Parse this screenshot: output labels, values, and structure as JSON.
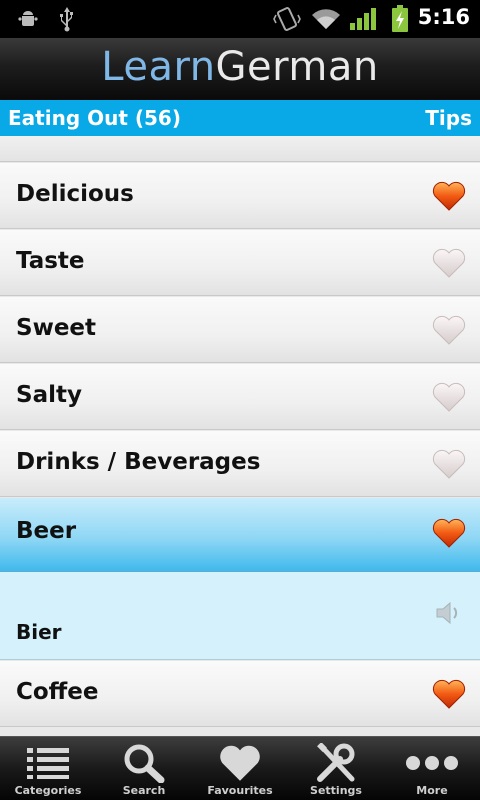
{
  "status_bar": {
    "time": "5:16",
    "icons": [
      "android-debug-icon",
      "usb-icon",
      "vibrate-icon",
      "wifi-icon",
      "signal-icon",
      "battery-charging-icon"
    ]
  },
  "header": {
    "logo_part1": "Learn",
    "logo_part2": "German"
  },
  "section": {
    "title": "Eating Out (56)",
    "tips_label": "Tips"
  },
  "list": {
    "items": [
      {
        "label": "Delicious",
        "favourite": true
      },
      {
        "label": "Taste",
        "favourite": false
      },
      {
        "label": "Sweet",
        "favourite": false
      },
      {
        "label": "Salty",
        "favourite": false
      },
      {
        "label": "Drinks / Beverages",
        "favourite": false
      },
      {
        "label": "Beer",
        "favourite": true,
        "selected": true
      },
      {
        "label": "Coffee",
        "favourite": true
      }
    ],
    "expanded_translation": "Bier"
  },
  "bottom_nav": {
    "categories": "Categories",
    "search": "Search",
    "favourites": "Favourites",
    "settings": "Settings",
    "more": "More"
  },
  "colors": {
    "accent": "#09a8e6",
    "selected_row": "#8fd7f5",
    "heart_active": "#f25a12",
    "heart_inactive": "#e4dcdc"
  }
}
